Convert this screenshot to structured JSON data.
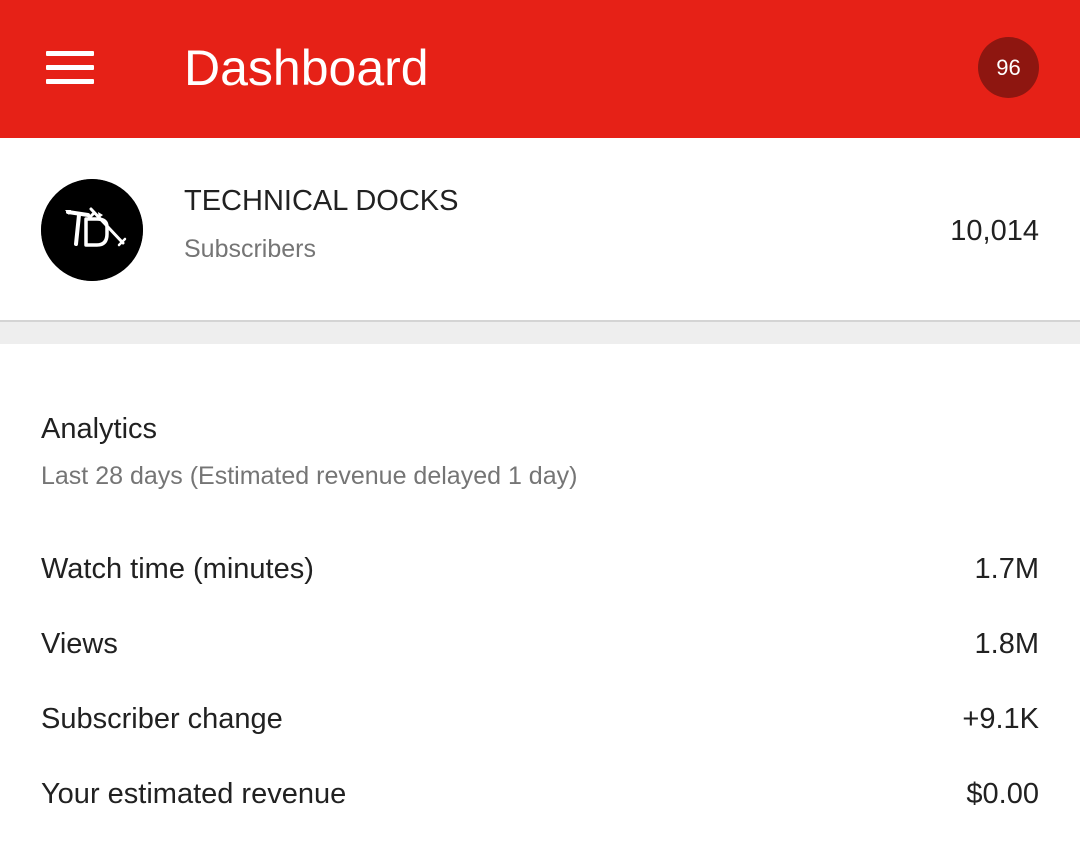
{
  "app_bar": {
    "title": "Dashboard",
    "menu_icon": "hamburger-menu-icon",
    "notification_count": "96",
    "background_color": "#e62117"
  },
  "channel": {
    "name": "TECHNICAL DOCKS",
    "subscribers_label": "Subscribers",
    "subscriber_count": "10,014",
    "avatar_icon": "channel-logo-icon"
  },
  "analytics": {
    "title": "Analytics",
    "subtitle": "Last 28 days (Estimated revenue delayed 1 day)",
    "metrics": [
      {
        "label": "Watch time (minutes)",
        "value": "1.7M"
      },
      {
        "label": "Views",
        "value": "1.8M"
      },
      {
        "label": "Subscriber change",
        "value": "+9.1K"
      },
      {
        "label": "Your estimated revenue",
        "value": "$0.00"
      }
    ]
  }
}
